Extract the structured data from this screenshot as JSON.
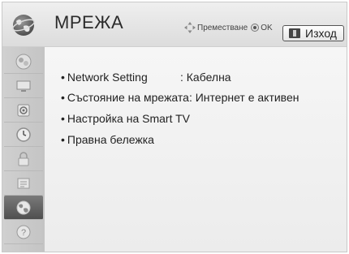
{
  "header": {
    "title": "МРЕЖА",
    "nav_hint": "Преместване",
    "ok_label": "OK",
    "exit_label": "Изход"
  },
  "sidebar": {
    "items": [
      {
        "icon": "picture-icon",
        "active": false
      },
      {
        "icon": "screen-icon",
        "active": false
      },
      {
        "icon": "audio-icon",
        "active": false
      },
      {
        "icon": "clock-icon",
        "active": false
      },
      {
        "icon": "lock-icon",
        "active": false
      },
      {
        "icon": "options-icon",
        "active": false
      },
      {
        "icon": "network-icon",
        "active": true
      },
      {
        "icon": "support-icon",
        "active": false
      }
    ]
  },
  "menu": {
    "items": [
      {
        "label": "Network Setting",
        "value": ": Кабелна"
      },
      {
        "label": "Състояние на мрежата: Интернет е активен",
        "value": ""
      },
      {
        "label": "Настройка на Smart TV",
        "value": ""
      },
      {
        "label": "Правна бележка",
        "value": ""
      }
    ]
  },
  "colors": {
    "background": "#e4e4e4",
    "sidebar": "#c8c8c8",
    "active_item": "#5c5c5c",
    "text": "#222222"
  }
}
